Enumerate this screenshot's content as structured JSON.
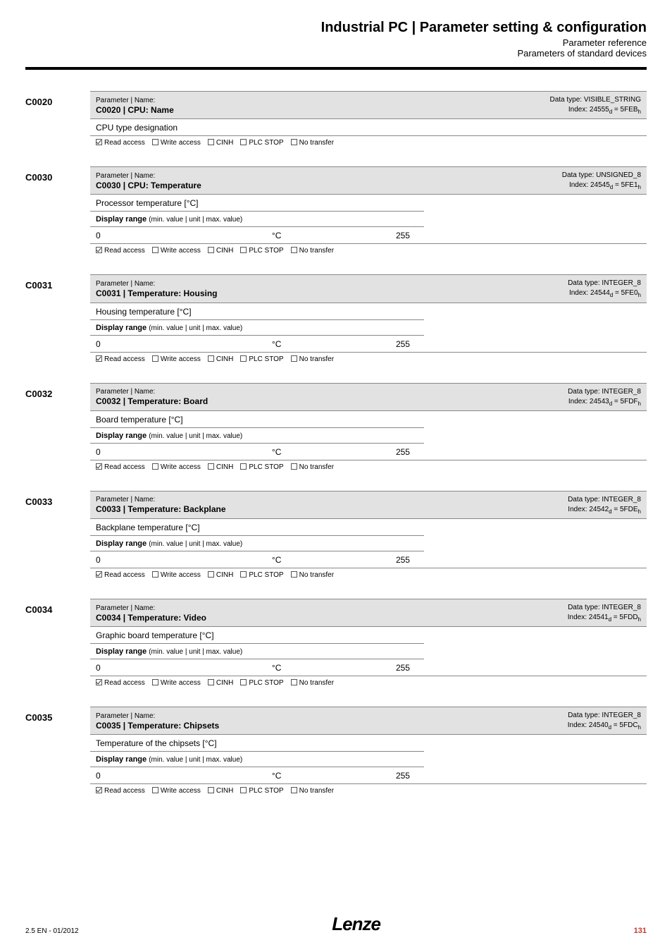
{
  "header": {
    "title": "Industrial PC | Parameter setting & configuration",
    "sub1": "Parameter reference",
    "sub2": "Parameters of standard devices"
  },
  "labels": {
    "param_name": "Parameter | Name:",
    "display_range": "Display range",
    "display_range_detail": "(min. value | unit | max. value)"
  },
  "flags": {
    "read": "Read access",
    "write": "Write access",
    "cinh": "CINH",
    "plcstop": "PLC STOP",
    "notransfer": "No transfer"
  },
  "params": [
    {
      "code": "C0020",
      "name": "C0020 | CPU: Name",
      "dtype": "VISIBLE_STRING",
      "index_d": "24555",
      "index_h": "5FEB",
      "desc": "CPU type designation",
      "has_range": false
    },
    {
      "code": "C0030",
      "name": "C0030 | CPU: Temperature",
      "dtype": "UNSIGNED_8",
      "index_d": "24545",
      "index_h": "5FE1",
      "desc": "Processor temperature [°C]",
      "has_range": true,
      "min": "0",
      "unit": "°C",
      "max": "255"
    },
    {
      "code": "C0031",
      "name": "C0031 | Temperature: Housing",
      "dtype": "INTEGER_8",
      "index_d": "24544",
      "index_h": "5FE0",
      "desc": "Housing temperature [°C]",
      "has_range": true,
      "min": "0",
      "unit": "°C",
      "max": "255"
    },
    {
      "code": "C0032",
      "name": "C0032 | Temperature: Board",
      "dtype": "INTEGER_8",
      "index_d": "24543",
      "index_h": "5FDF",
      "desc": "Board temperature [°C]",
      "has_range": true,
      "min": "0",
      "unit": "°C",
      "max": "255"
    },
    {
      "code": "C0033",
      "name": "C0033 | Temperature: Backplane",
      "dtype": "INTEGER_8",
      "index_d": "24542",
      "index_h": "5FDE",
      "desc": "Backplane temperature [°C]",
      "has_range": true,
      "min": "0",
      "unit": "°C",
      "max": "255"
    },
    {
      "code": "C0034",
      "name": "C0034 | Temperature: Video",
      "dtype": "INTEGER_8",
      "index_d": "24541",
      "index_h": "5FDD",
      "desc": "Graphic board temperature [°C]",
      "has_range": true,
      "min": "0",
      "unit": "°C",
      "max": "255"
    },
    {
      "code": "C0035",
      "name": "C0035 | Temperature: Chipsets",
      "dtype": "INTEGER_8",
      "index_d": "24540",
      "index_h": "5FDC",
      "desc": "Temperature of the chipsets [°C]",
      "has_range": true,
      "min": "0",
      "unit": "°C",
      "max": "255"
    }
  ],
  "footer": {
    "left": "2.5 EN - 01/2012",
    "logo": "Lenze",
    "page": "131"
  }
}
